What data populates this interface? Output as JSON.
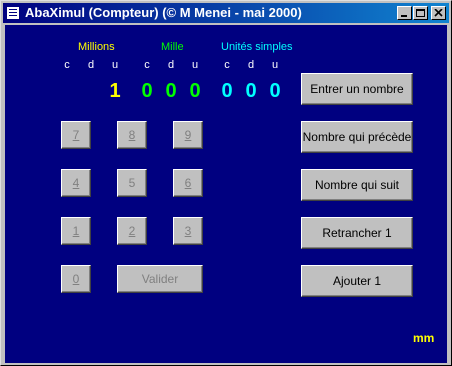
{
  "window": {
    "title": "AbaXimul (Compteur) (© M Menei - mai 2000)"
  },
  "groups": [
    {
      "label": "Millions",
      "color": "#ffff00",
      "subs": [
        "c",
        "d",
        "u"
      ]
    },
    {
      "label": "Mille",
      "color": "#00ff00",
      "subs": [
        "c",
        "d",
        "u"
      ]
    },
    {
      "label": "Unités simples",
      "color": "#00ffff",
      "subs": [
        "c",
        "d",
        "u"
      ]
    }
  ],
  "display": {
    "millions_u": "1",
    "mille": [
      "0",
      "0",
      "0"
    ],
    "unites": [
      "0",
      "0",
      "0"
    ]
  },
  "keypad": {
    "k7": "7",
    "k8": "8",
    "k9": "9",
    "k4": "4",
    "k5": "5",
    "k6": "6",
    "k1": "1",
    "k2": "2",
    "k3": "3",
    "k0": "0",
    "valider": "Valider"
  },
  "actions": {
    "entrer": "Entrer un nombre",
    "precede": "Nombre qui précède",
    "suit": "Nombre qui suit",
    "retrancher": "Retrancher 1",
    "ajouter": "Ajouter 1"
  },
  "footer": {
    "mark": "mm"
  },
  "colors": {
    "background": "#000080",
    "millions": "#ffff00",
    "mille": "#00ff00",
    "unites": "#00ffff"
  }
}
